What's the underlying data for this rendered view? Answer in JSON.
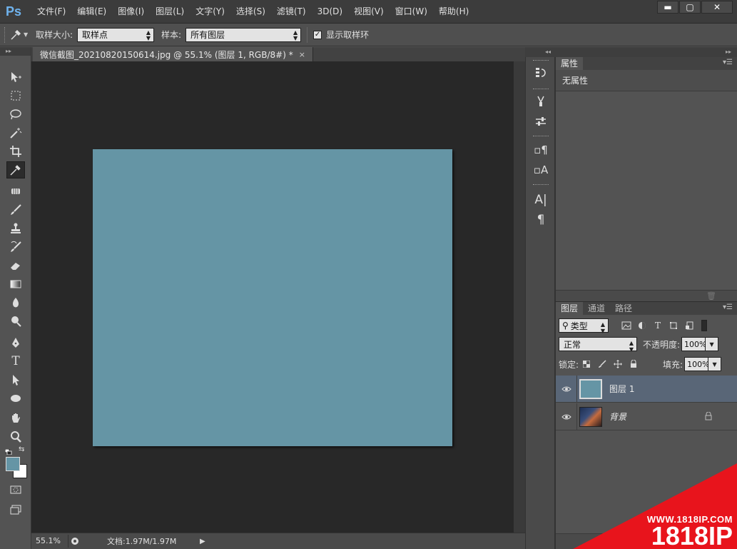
{
  "app": {
    "logo": "Ps"
  },
  "menu": [
    "文件(F)",
    "编辑(E)",
    "图像(I)",
    "图层(L)",
    "文字(Y)",
    "选择(S)",
    "滤镜(T)",
    "3D(D)",
    "视图(V)",
    "窗口(W)",
    "帮助(H)"
  ],
  "window_controls": {
    "minimize": "▬",
    "maximize": "▢",
    "close": "✕"
  },
  "options_bar": {
    "tool_icon": "eyedropper-icon",
    "sample_size_label": "取样大小:",
    "sample_size_value": "取样点",
    "sample_label": "样本:",
    "sample_value": "所有图层",
    "show_ring_label": "显示取样环",
    "show_ring_checked": true
  },
  "document": {
    "tab_title": "微信截图_20210820150614.jpg @ 55.1% (图层 1, RGB/8#) *",
    "close": "×",
    "canvas_color": "#6595a5"
  },
  "status": {
    "zoom": "55.1%",
    "doc_size": "文档:1.97M/1.97M",
    "arrow": "▶"
  },
  "tools": [
    "move-icon",
    "marquee-icon",
    "lasso-icon",
    "magic-wand-icon",
    "crop-icon",
    "eyedropper-icon",
    "spot-heal-icon",
    "brush-icon",
    "stamp-icon",
    "history-brush-icon",
    "eraser-icon",
    "gradient-icon",
    "blur-icon",
    "dodge-icon",
    "pen-icon",
    "type-icon",
    "path-select-icon",
    "ellipse-icon",
    "hand-icon",
    "zoom-icon"
  ],
  "colors": {
    "foreground": "#6595a5",
    "background": "#ffffff",
    "accent": "#596677"
  },
  "properties_panel": {
    "tab": "属性",
    "empty_text": "无属性"
  },
  "layers_panel": {
    "tabs": [
      "图层",
      "通道",
      "路径"
    ],
    "filter": "类型",
    "blend_mode": "正常",
    "opacity_label": "不透明度:",
    "opacity": "100%",
    "lock_label": "锁定:",
    "fill_label": "填充:",
    "fill": "100%",
    "layers": [
      {
        "name": "图层 1",
        "selected": true,
        "locked": false
      },
      {
        "name": "背景",
        "selected": false,
        "locked": true
      }
    ]
  },
  "watermark": {
    "url": "WWW.1818IP.COM",
    "brand": "1818IP"
  }
}
